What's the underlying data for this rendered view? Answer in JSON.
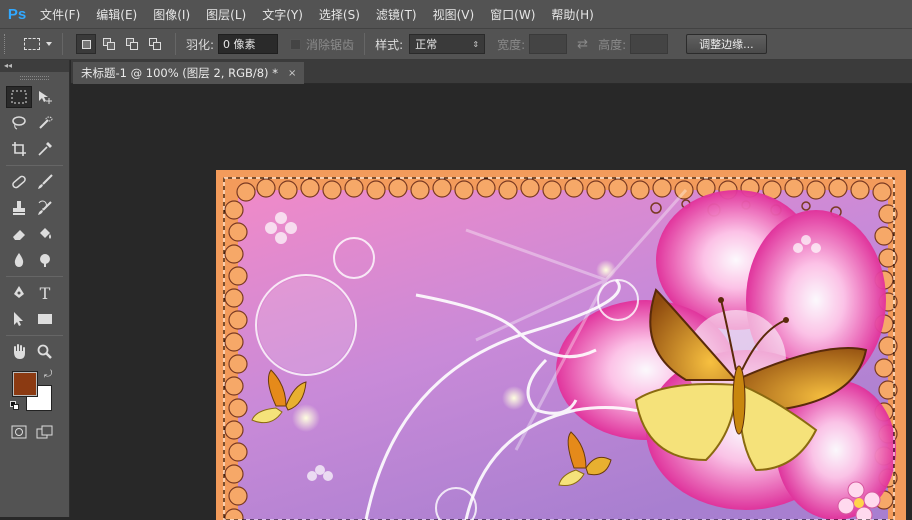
{
  "app": {
    "logo": "Ps"
  },
  "menu": [
    "文件(F)",
    "编辑(E)",
    "图像(I)",
    "图层(L)",
    "文字(Y)",
    "选择(S)",
    "滤镜(T)",
    "视图(V)",
    "窗口(W)",
    "帮助(H)"
  ],
  "options": {
    "feather_label": "羽化:",
    "feather_value": "0 像素",
    "antialias_label": "消除锯齿",
    "style_label": "样式:",
    "style_value": "正常",
    "width_label": "宽度:",
    "height_label": "高度:",
    "refine_edge_label": "调整边缘..."
  },
  "document": {
    "tab_title": "未标题-1 @ 100% (图层 2, RGB/8) *",
    "close": "×"
  },
  "tools": {
    "collapse": "◂◂",
    "rows": [
      [
        "marquee-tool",
        "move-tool"
      ],
      [
        "lasso-tool",
        "quick-selection-tool"
      ],
      [
        "crop-tool",
        "eyedropper-tool"
      ],
      [
        "healing-brush-tool",
        "brush-tool"
      ],
      [
        "clone-stamp-tool",
        "history-brush-tool"
      ],
      [
        "eraser-tool",
        "paint-bucket-tool"
      ],
      [
        "blur-tool",
        "dodge-tool"
      ],
      [
        "pen-tool",
        "type-tool"
      ],
      [
        "path-selection-tool",
        "rectangle-tool"
      ],
      [
        "hand-tool",
        "zoom-tool"
      ]
    ],
    "type_glyph": "T",
    "foreground_color": "#8b3a12",
    "background_color": "#ffffff"
  }
}
